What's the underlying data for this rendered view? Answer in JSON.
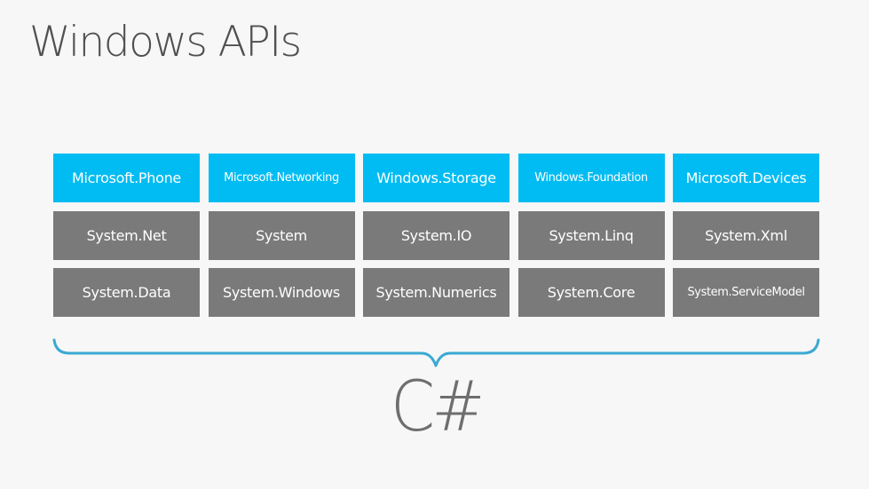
{
  "title": "Windows APIs",
  "colors": {
    "blue_tile": "#00bcf2",
    "gray_tile": "#7a7a7a",
    "brace": "#3ba9d3",
    "title_text": "#505050",
    "background": "#f7f7f7"
  },
  "rows": [
    {
      "style": "blue",
      "tiles": [
        {
          "label": "Microsoft.Phone",
          "size": "normal"
        },
        {
          "label": "Microsoft.Networking",
          "size": "small"
        },
        {
          "label": "Windows.Storage",
          "size": "normal"
        },
        {
          "label": "Windows.Foundation",
          "size": "small"
        },
        {
          "label": "Microsoft.Devices",
          "size": "normal"
        }
      ]
    },
    {
      "style": "gray",
      "tiles": [
        {
          "label": "System.Net",
          "size": "normal"
        },
        {
          "label": "System",
          "size": "normal"
        },
        {
          "label": "System.IO",
          "size": "normal"
        },
        {
          "label": "System.Linq",
          "size": "normal"
        },
        {
          "label": "System.Xml",
          "size": "normal"
        }
      ]
    },
    {
      "style": "gray",
      "tiles": [
        {
          "label": "System.Data",
          "size": "normal"
        },
        {
          "label": "System.Windows",
          "size": "normal"
        },
        {
          "label": "System.Numerics",
          "size": "normal"
        },
        {
          "label": "System.Core",
          "size": "normal"
        },
        {
          "label": "System.ServiceModel",
          "size": "small"
        }
      ]
    }
  ],
  "footer_label": "C#"
}
